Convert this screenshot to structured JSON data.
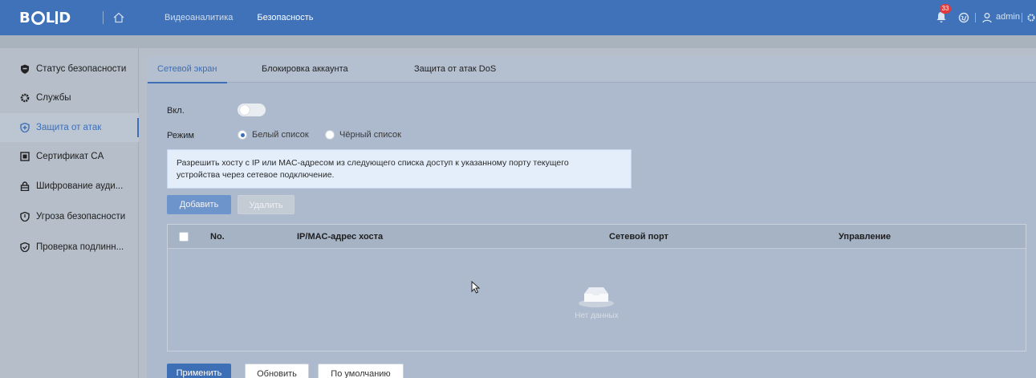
{
  "header": {
    "logo": "BOLID",
    "nav": [
      "Видеоаналитика",
      "Безопасность"
    ],
    "active_nav": "Безопасность",
    "notification_count": "33",
    "user": "admin",
    "icons": [
      "home-icon",
      "bell-icon",
      "globe-icon",
      "user-icon",
      "gear-icon"
    ]
  },
  "sidebar": {
    "items": [
      {
        "label": "Статус безопасности",
        "icon": "shield-icon"
      },
      {
        "label": "Службы",
        "icon": "gear-icon"
      },
      {
        "label": "Защита от атак",
        "icon": "shield-plus-icon"
      },
      {
        "label": "Сертификат CA",
        "icon": "certificate-icon"
      },
      {
        "label": "Шифрование ауди...",
        "icon": "lock-icon"
      },
      {
        "label": "Угроза безопасности",
        "icon": "shield-icon"
      },
      {
        "label": "Проверка подлинн...",
        "icon": "shield-check-icon"
      }
    ],
    "active_index": 2
  },
  "tabs": [
    "Сетевой экран",
    "Блокировка аккаунта",
    "Защита от атак DoS"
  ],
  "form": {
    "enable_label": "Вкл.",
    "enabled": false,
    "mode_label": "Режим",
    "mode_options": [
      "Белый список",
      "Чёрный список"
    ],
    "mode_selected": "Белый список",
    "notice_line1": "Разрешить хосту с IP или MAC-адресом из следующего списка доступ к указанному порту текущего",
    "notice_line2": "устройства через сетевое подключение."
  },
  "actions": {
    "add": "Добавить",
    "delete": "Удалить"
  },
  "table": {
    "columns": [
      "No.",
      "IP/MAC-адрес хоста",
      "Сетевой порт",
      "Управление"
    ],
    "rows": [],
    "empty_text": "Нет данных"
  },
  "footer": {
    "apply": "Применить",
    "refresh": "Обновить",
    "default": "По умолчанию"
  },
  "colors": {
    "accent": "#3d6fb6",
    "topbar": "#3f72b9",
    "badge": "#e13a3a"
  }
}
